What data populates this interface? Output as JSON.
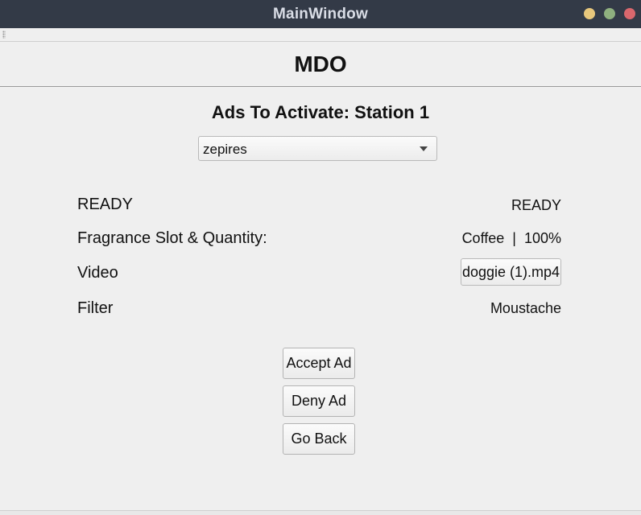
{
  "window": {
    "title": "MainWindow"
  },
  "header": {
    "title": "MDO"
  },
  "section": {
    "title": "Ads To Activate: Station 1"
  },
  "ad_select": {
    "selected": "zepires"
  },
  "rows": {
    "status": {
      "label": "READY",
      "value": "READY"
    },
    "fragrance": {
      "label": "Fragrance Slot & Quantity:",
      "value": "Coffee  |  100%"
    },
    "video": {
      "label": "Video",
      "value": "doggie (1).mp4"
    },
    "filter": {
      "label": "Filter",
      "value": "Moustache"
    }
  },
  "buttons": {
    "accept": "Accept Ad",
    "deny": "Deny Ad",
    "back": "Go Back"
  },
  "colors": {
    "titlebar": "#333a47",
    "background": "#efefef",
    "minimize": "#e7c77c",
    "maximize": "#8fb07f",
    "close": "#d9676d"
  }
}
